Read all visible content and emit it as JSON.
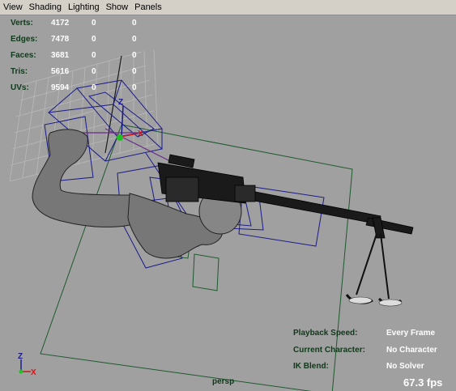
{
  "menubar": {
    "items": [
      "View",
      "Shading",
      "Lighting",
      "Show",
      "Panels"
    ]
  },
  "stats": [
    {
      "label": "Verts:",
      "values": [
        "4172",
        "0",
        "0"
      ]
    },
    {
      "label": "Edges:",
      "values": [
        "7478",
        "0",
        "0"
      ]
    },
    {
      "label": "Faces:",
      "values": [
        "3681",
        "0",
        "0"
      ]
    },
    {
      "label": "Tris:",
      "values": [
        "5616",
        "0",
        "0"
      ]
    },
    {
      "label": "UVs:",
      "values": [
        "9594",
        "0",
        "0"
      ]
    }
  ],
  "hud_right": [
    {
      "label": "Playback Speed:",
      "value": "Every Frame"
    },
    {
      "label": "Current Character:",
      "value": "No Character"
    },
    {
      "label": "IK Blend:",
      "value": "No Solver"
    }
  ],
  "viewport": {
    "camera": "persp",
    "fps": "67.3 fps",
    "axis_labels": {
      "z": "Z",
      "x": "X"
    }
  },
  "colors": {
    "viewport_bg": "#a0a0a0",
    "menubar_bg": "#d4d0c8",
    "hud_label": "#10381a",
    "hud_value": "#ffffff",
    "wire_blue": "#1a1a8a",
    "wire_green": "#1e5a2e"
  }
}
